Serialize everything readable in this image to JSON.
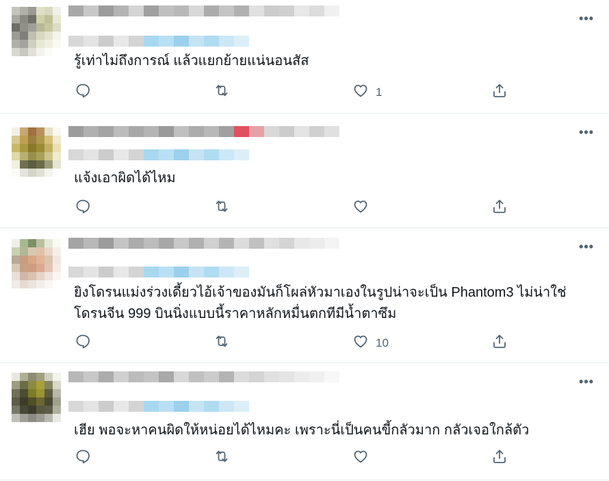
{
  "tweets": [
    {
      "text": "รู้เท่าไม่ถึงการณ์ แล้วแยกย้ายแน่นอนสัส",
      "replies": "",
      "retweets": "",
      "likes": "1",
      "avatar_colors": [
        "#c4c4bc",
        "#b0b0a8",
        "#9a9a92",
        "#e0e0c8",
        "#d8d8c0",
        "#f0f0e8",
        "#a8a8a0",
        "#8a8a82",
        "#707068",
        "#d0d0a8",
        "#c0c098",
        "#e8e8d8",
        "#6e6e66",
        "#909088",
        "#a0a098",
        "#b8b898",
        "#c8c8a0",
        "#dcdcc8",
        "#9c9c94",
        "#808078",
        "#c0c0b0",
        "#d8d8c0",
        "#e4e4d0",
        "#f4f4ec",
        "#b0b0a8",
        "#a4a49c",
        "#d0d0c0",
        "#e8e8d4",
        "#f0f0e0",
        "#fafaf4",
        "#d8d8d0",
        "#c8c8c0",
        "#e0e0d8",
        "#f4f4ee",
        "#fafaf8",
        "#ffffff"
      ]
    },
    {
      "text": "แจ้งเอาผิดได้ไหม",
      "replies": "",
      "retweets": "",
      "likes": "",
      "avatar_colors": [
        "#f4f0e4",
        "#c8a870",
        "#a07040",
        "#b89060",
        "#e8e0c8",
        "#faf8f0",
        "#d8c890",
        "#c0a050",
        "#9c8040",
        "#b09848",
        "#d4c078",
        "#f0e8d0",
        "#c8b868",
        "#a89840",
        "#887828",
        "#9c8c38",
        "#c0b060",
        "#e8e0b0",
        "#e0d8a8",
        "#b8b070",
        "#989048",
        "#a8a058",
        "#ccc488",
        "#f0ecd0",
        "#f0f0e0",
        "#707050",
        "#5c5c40",
        "#6c6c48",
        "#9c9c78",
        "#e4e4d4",
        "#fafaf8",
        "#e4e4dc",
        "#d4d4c8",
        "#e0e0d4",
        "#f4f4ee",
        "#ffffff"
      ]
    },
    {
      "text": "ยิงโดรนแม่งร่วงเดี้ยวไอ้เจ้าของมันก็โผล่หัวมาเองในรูปน่าจะเป็น Phantom3 ไม่น่าใช่\nโดรนจีน 999 บินนิ่งแบบนี้ราคาหลักหมื่นตกทีมีน้ำตาซึม",
      "replies": "",
      "retweets": "",
      "likes": "10",
      "avatar_colors": [
        "#f0f0e8",
        "#a8b890",
        "#7c9068",
        "#b8c0a0",
        "#e4e8d8",
        "#fafaf4",
        "#c8d0b0",
        "#b0b898",
        "#d8c8b0",
        "#e0c0a8",
        "#e8d8c8",
        "#f4f0e8",
        "#b8a898",
        "#c89c80",
        "#d8a888",
        "#e4b498",
        "#dcc4b0",
        "#f0e8e0",
        "#d8c8b8",
        "#c8a088",
        "#d09c80",
        "#dca890",
        "#e4c4b0",
        "#f4ece4",
        "#e8e0d8",
        "#d0b8a8",
        "#dcc0b0",
        "#e8d4c8",
        "#f0e4dc",
        "#faf6f2",
        "#f0ece8",
        "#e4dcd4",
        "#ece4dc",
        "#f4eee8",
        "#faf8f6",
        "#ffffff"
      ]
    },
    {
      "text": "เฮีย พอจะหาคนผิดให้หน่อยได้ไหมคะ เพราะนี่เป็นคนขี้กลัวมาก กลัวเจอใกล้ตัว",
      "replies": "",
      "retweets": "",
      "likes": "",
      "avatar_colors": [
        "#e8e8e0",
        "#b0b098",
        "#8c8c70",
        "#a0a080",
        "#d0d0c0",
        "#f4f4ee",
        "#9c9c80",
        "#6c6c48",
        "#8a8a40",
        "#a8a038",
        "#848460",
        "#d8d8c8",
        "#707058",
        "#4c4c30",
        "#7c7c28",
        "#9c9430",
        "#605c40",
        "#b8b8a8",
        "#5c5c48",
        "#3c3c28",
        "#505028",
        "#6c6830",
        "#484830",
        "#a0a090",
        "#787868",
        "#484838",
        "#3c3c2c",
        "#585840",
        "#5c5c48",
        "#b0b0a0",
        "#c0c0b8",
        "#a0a098",
        "#8c8c84",
        "#9c9c94",
        "#b8b8b0",
        "#e8e8e4"
      ]
    }
  ],
  "icons": {
    "reply": "reply-icon",
    "retweet": "retweet-icon",
    "like": "heart-icon",
    "share": "share-icon",
    "more": "more-icon"
  },
  "more_label": "•••"
}
